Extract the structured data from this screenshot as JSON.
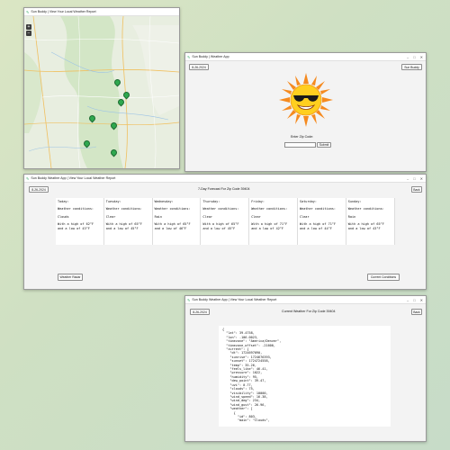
{
  "map_window": {
    "title": "Sun Buddy | View Your Local Weather Report",
    "zoom_in": "+",
    "zoom_out": "−"
  },
  "sun_window": {
    "title": "Sun Buddy | Weather App",
    "date": "8-26-2024",
    "top_right_button": "Sun Buddy",
    "prompt": "Enter Zip Code:",
    "zip_value": "",
    "submit": "Submit"
  },
  "forecast_window": {
    "title": "Sun Buddy Weather App | View Your Local Weather Report",
    "date": "8-26-2024",
    "heading": "7-Day Forecast For Zip Code 39404",
    "back": "Back",
    "weather_radar_button": "Weather Radar",
    "current_conditions_button": "Current Conditions",
    "days": [
      {
        "day": "Today:",
        "cond_label": "Weather conditions:",
        "cond": "Clouds",
        "high": "With a high of 62°F",
        "low": "and a low of 43°F"
      },
      {
        "day": "Tuesday:",
        "cond_label": "Weather conditions:",
        "cond": "Clear",
        "high": "With a high of 65°F",
        "low": "and a low of 45°F"
      },
      {
        "day": "Wednesday:",
        "cond_label": "Weather conditions:",
        "cond": "Rain",
        "high": "With a high of 65°F",
        "low": "and a low of 46°F"
      },
      {
        "day": "Thursday:",
        "cond_label": "Weather conditions:",
        "cond": "Clear",
        "high": "With a high of 65°F",
        "low": "and a low of 45°F"
      },
      {
        "day": "Friday:",
        "cond_label": "Weather conditions:",
        "cond": "Clear",
        "high": "With a high of 71°F",
        "low": "and a low of 42°F"
      },
      {
        "day": "Saturday:",
        "cond_label": "Weather conditions:",
        "cond": "Clear",
        "high": "With a high of 71°F",
        "low": "and a low of 44°F"
      },
      {
        "day": "Sunday:",
        "cond_label": "Weather conditions:",
        "cond": "Rain",
        "high": "With a high of 65°F",
        "low": "and a low of 43°F"
      }
    ]
  },
  "current_window": {
    "title": "Sun Buddy Weather App | View Your Local Weather Report",
    "date": "8-26-2024",
    "heading": "Current Weather For Zip Code 39404",
    "back": "Back",
    "json_lines": [
      "{",
      "  \"lat\": 39.4758,",
      "  \"lon\": -106.0023,",
      "  \"timezone\": \"America/Denver\",",
      "  \"timezone_offset\": -21600,",
      "  \"current\": {",
      "    \"dt\": 1724697090,",
      "    \"sunrise\": 1724676393,",
      "    \"sunset\": 1724724558,",
      "    \"temp\": 35.26,",
      "    \"feels_like\": 46.41,",
      "    \"pressure\": 1022,",
      "    \"humidity\": 95,",
      "    \"dew_point\": 39.47,",
      "    \"uvi\": 0.77,",
      "    \"clouds\": 75,",
      "    \"visibility\": 10000,",
      "    \"wind_speed\": 16.38,",
      "    \"wind_deg\": 234,",
      "    \"wind_gust\": 26.96,",
      "    \"weather\": [",
      "      {",
      "        \"id\": 803,",
      "        \"main\": \"Clouds\","
    ]
  },
  "colors": {
    "sun_body": "#ffcf1f",
    "sun_rays": "#f58a1f",
    "map_pin": "#2fa84f"
  }
}
